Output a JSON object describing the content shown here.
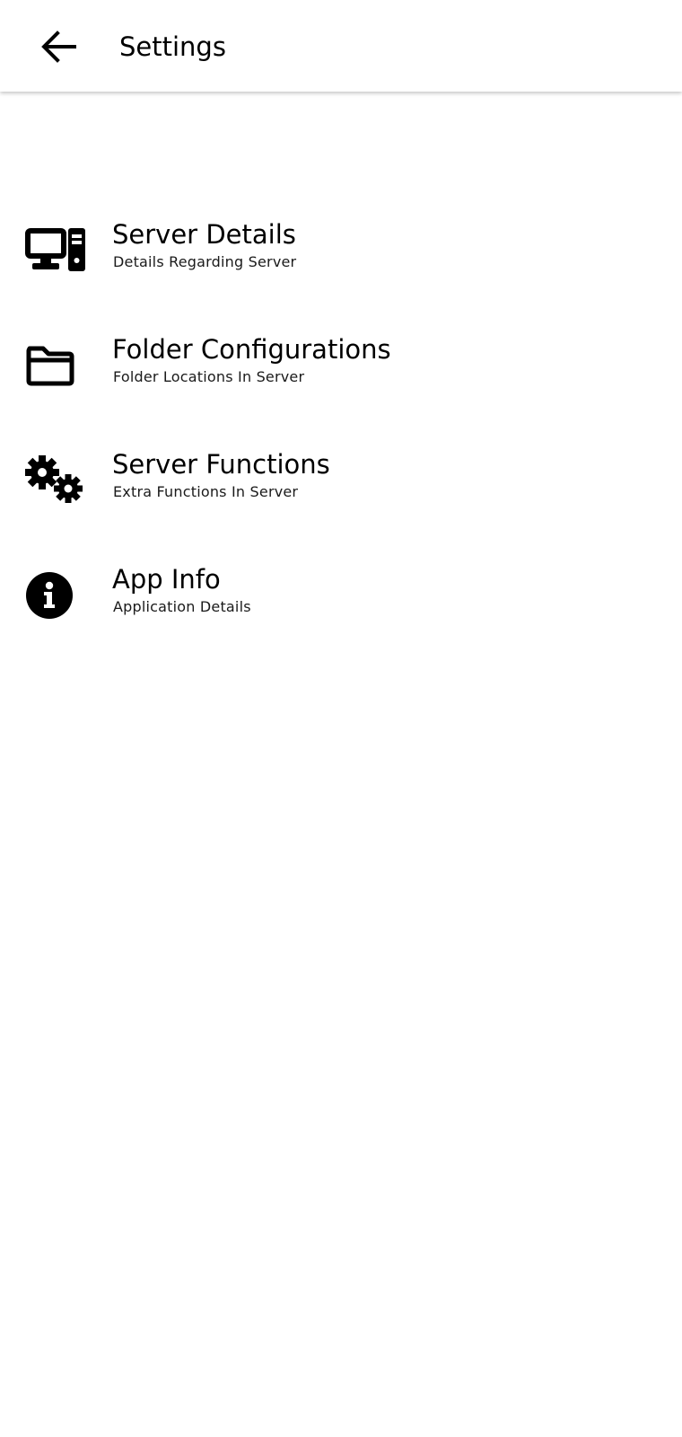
{
  "header": {
    "title": "Settings",
    "back_icon": "arrow-left-icon"
  },
  "settings": {
    "items": [
      {
        "title": "Server Details",
        "subtitle": "Details Regarding Server",
        "icon": "desktop-tower-icon"
      },
      {
        "title": "Folder Configurations",
        "subtitle": "Folder Locations In Server",
        "icon": "folder-icon"
      },
      {
        "title": "Server Functions",
        "subtitle": "Extra Functions In Server",
        "icon": "gears-icon"
      },
      {
        "title": "App Info",
        "subtitle": "Application Details",
        "icon": "info-circle-icon"
      }
    ]
  },
  "colors": {
    "background": "#ffffff",
    "text": "#000000"
  }
}
